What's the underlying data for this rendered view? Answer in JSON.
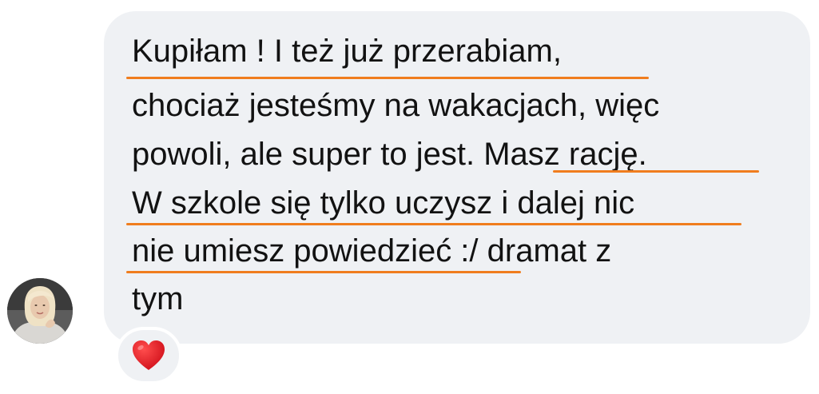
{
  "message": {
    "lines": [
      "Kupiłam ! I też już przerabiam,",
      "chociaż jesteśmy na wakacjach, więc",
      "powoli, ale super to jest. Masz rację.",
      "W szkole się tylko uczysz i dalej nic",
      "nie umiesz powiedzieć :/ dramat z",
      "tym"
    ]
  },
  "reaction": {
    "icon": "heart-icon",
    "color": "#e0141c"
  },
  "avatar": {
    "icon": "profile-photo"
  },
  "colors": {
    "bubble": "#eff1f4",
    "underline": "#f07d1e",
    "text": "#121212"
  }
}
